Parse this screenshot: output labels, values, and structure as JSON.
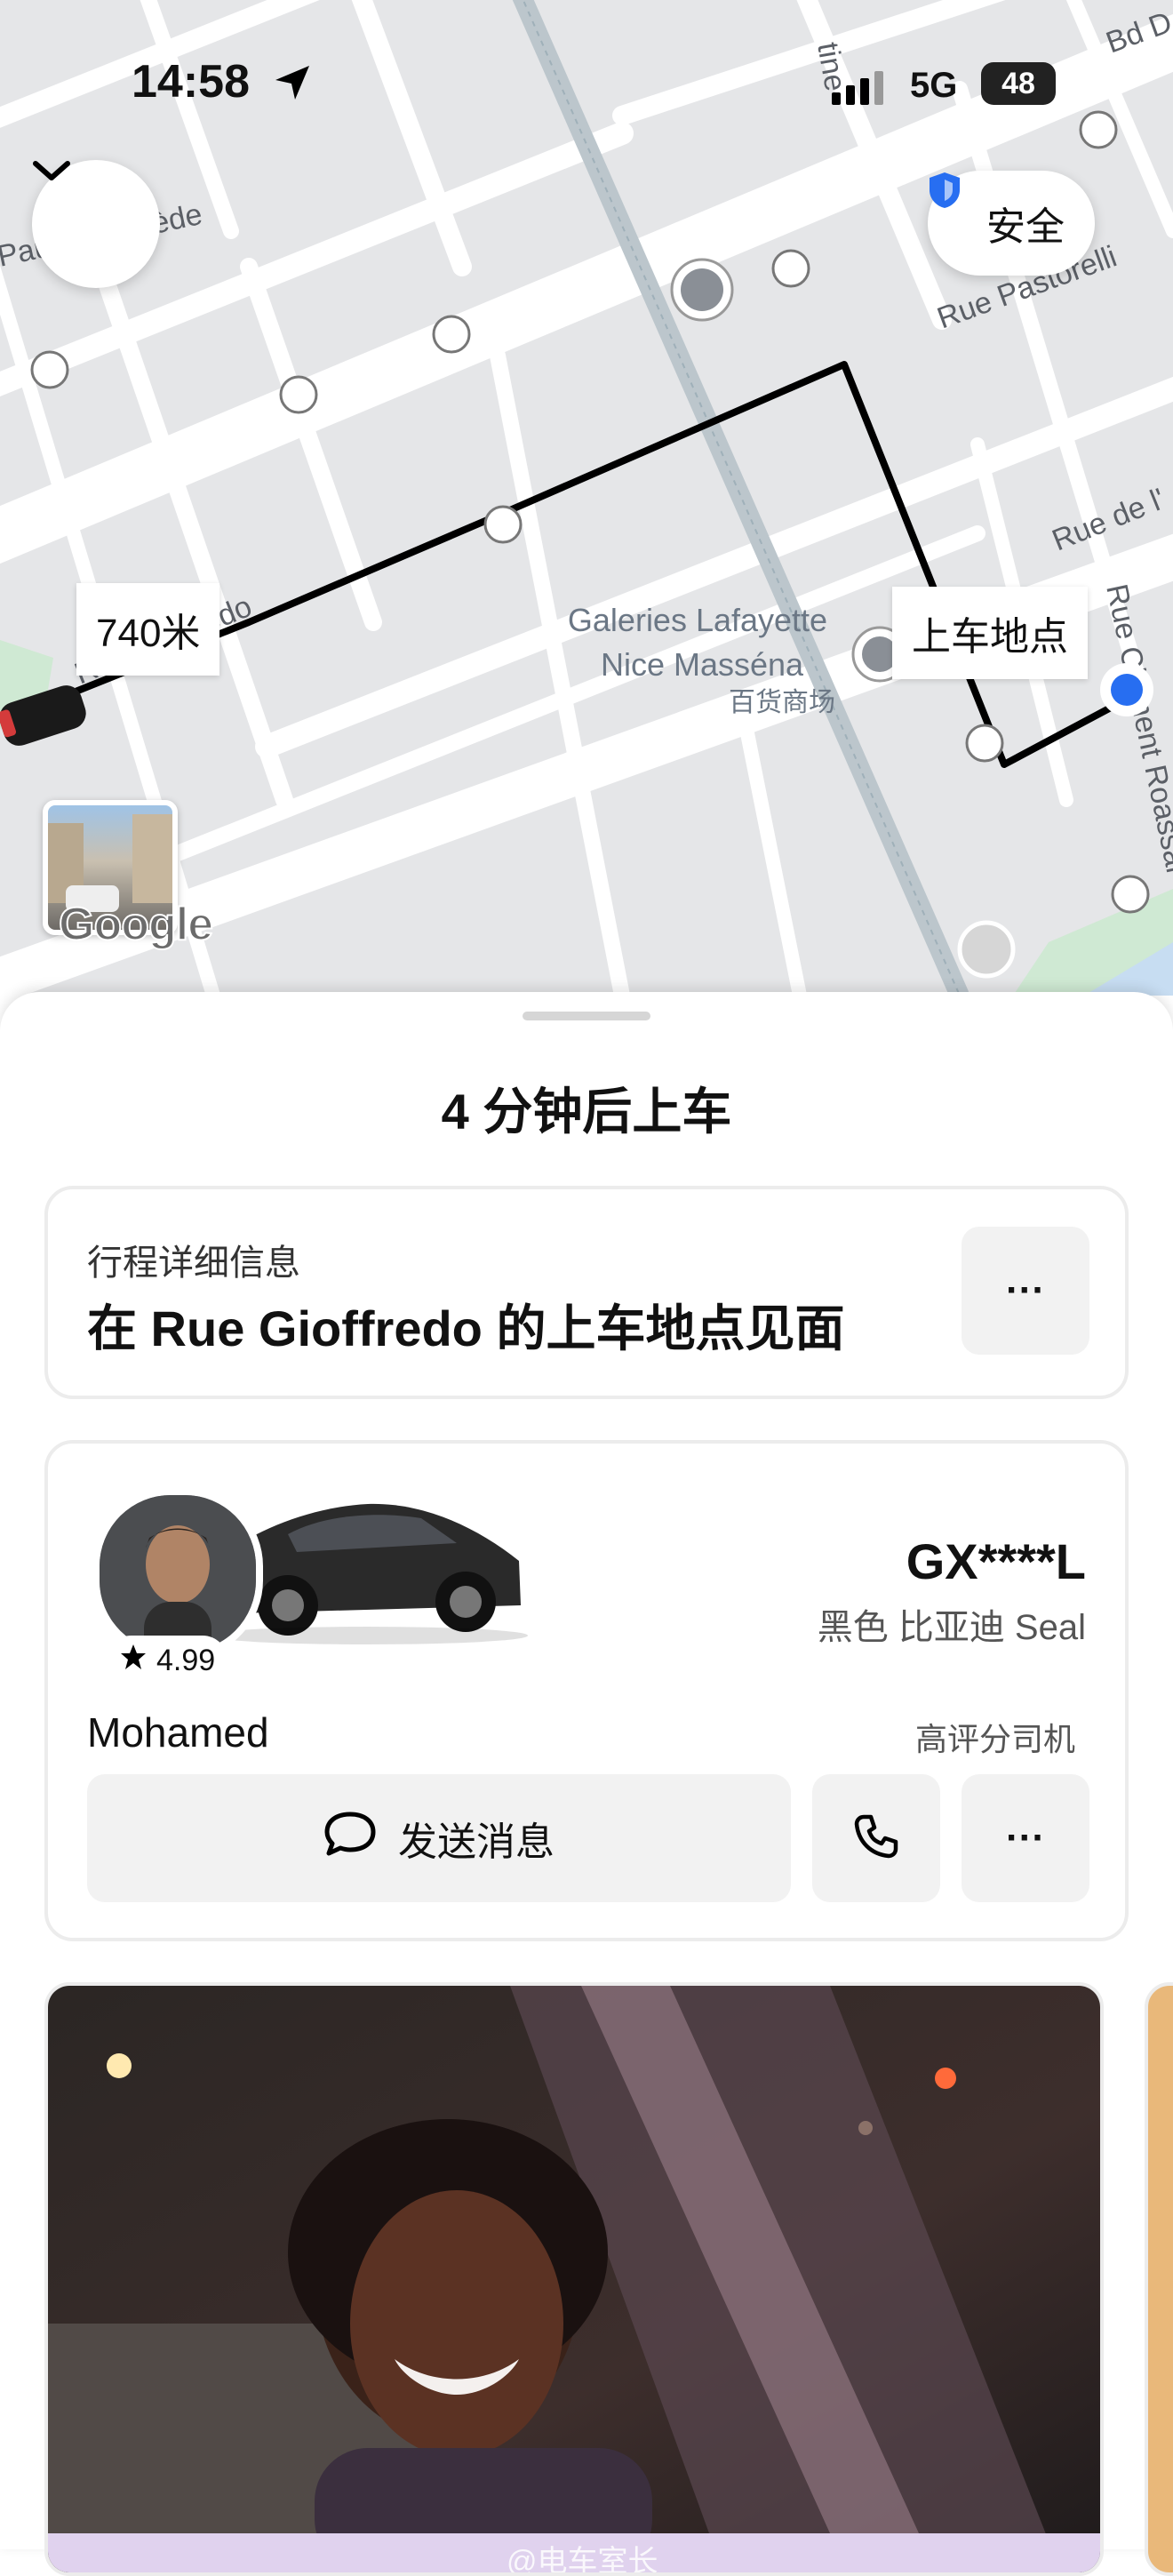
{
  "status_bar": {
    "time": "14:58",
    "network": "5G",
    "battery": "48"
  },
  "map": {
    "safety_label": "安全",
    "distance_label": "740米",
    "pickup_label": "上车地点",
    "streets": [
      "Paul Déroulède",
      "Rue Pastorelli",
      "Rue de l'",
      "Rue Gioffredo",
      "Rue Clément Roassal",
      "Bd D"
    ],
    "poi_name_line1": "Galeries Lafayette",
    "poi_name_line2": "Nice Masséna",
    "poi_name_cn": "百货商场",
    "google_logo": "Google",
    "route_color": "#000000",
    "location_color": "#276ef1"
  },
  "sheet": {
    "title": "4 分钟后上车",
    "trip_card": {
      "subtitle": "行程详细信息",
      "headline": "在 Rue Gioffredo 的上车地点见面",
      "more": "···"
    },
    "driver_card": {
      "rating": "4.99",
      "plate": "GX****L",
      "vehicle": "黑色 比亚迪 Seal",
      "driver_name": "Mohamed",
      "badge": "高评分司机",
      "message_label": "发送消息",
      "more": "···"
    },
    "promo": {
      "watermark": "@电车室长"
    }
  }
}
